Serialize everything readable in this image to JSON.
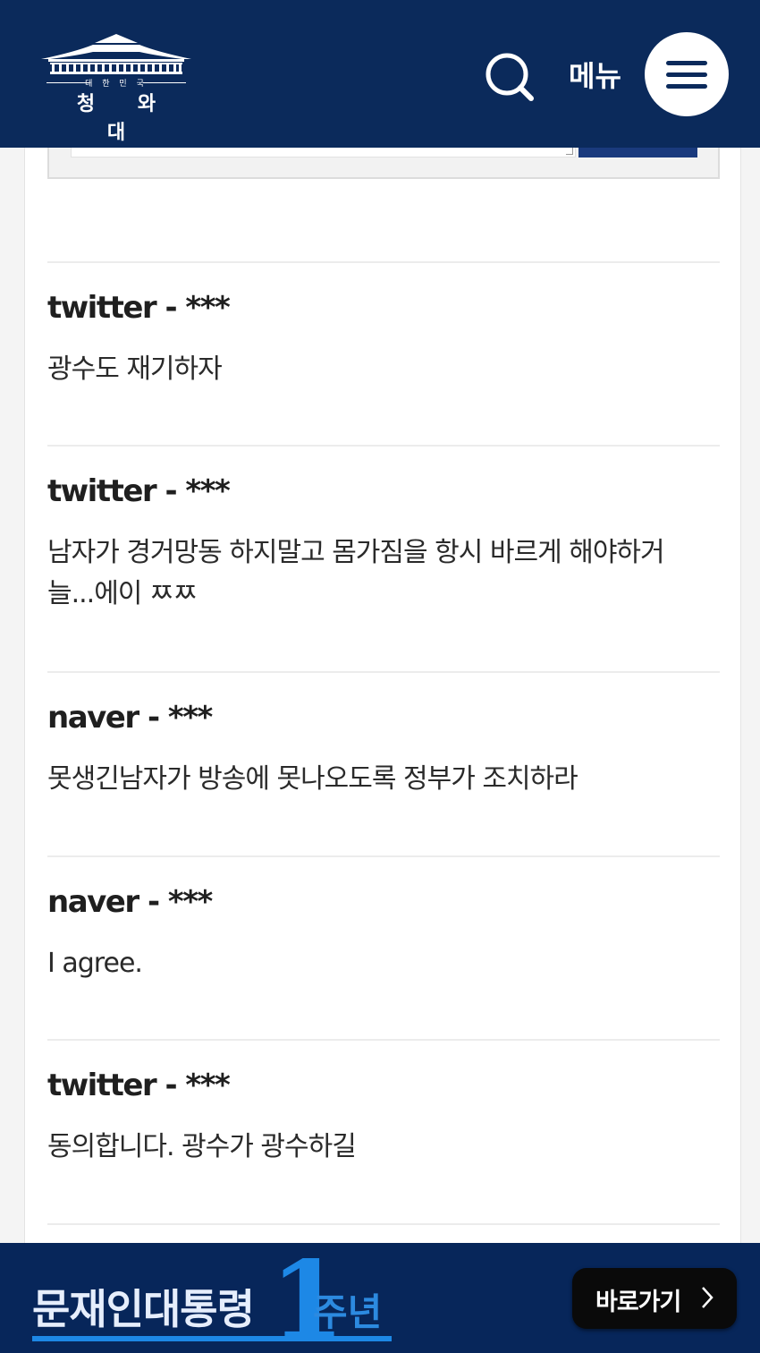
{
  "header": {
    "logo_small": "대 한 민 국",
    "logo_big": "청 와 대",
    "menu_label": "메뉴",
    "background": "#0b2a5b"
  },
  "comments": [
    {
      "author": "twitter - ***",
      "text": "광수도 재기하자"
    },
    {
      "author": "twitter - ***",
      "text": "남자가 경거망동 하지말고 몸가짐을 항시 바르게 해야하거늘...에이 ㅉㅉ"
    },
    {
      "author": "naver - ***",
      "text": "못생긴남자가 방송에 못나오도록 정부가 조치하라"
    },
    {
      "author": "naver - ***",
      "text": "I agree."
    },
    {
      "author": "twitter - ***",
      "text": "동의합니다. 광수가 광수하길"
    }
  ],
  "banner": {
    "title": "문재인대통령",
    "number": "1",
    "sub": "주년",
    "button_label": "바로가기",
    "accent": "#1d88e6"
  }
}
